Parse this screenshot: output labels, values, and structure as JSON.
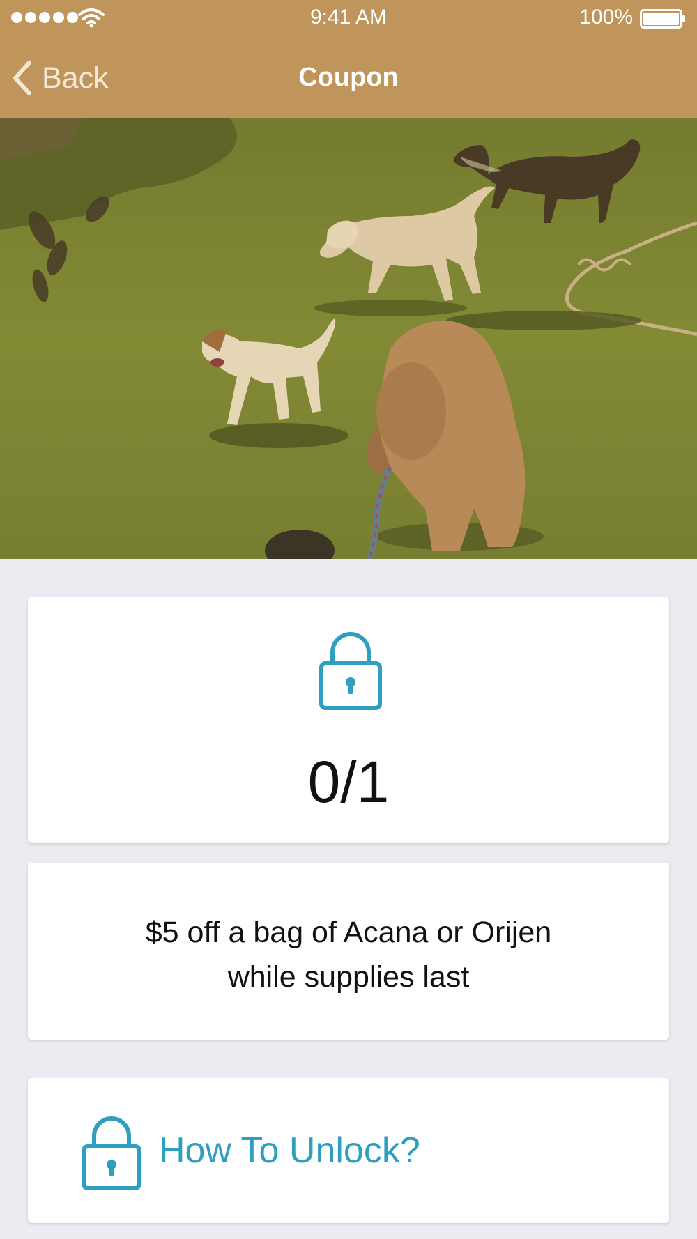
{
  "status_bar": {
    "time": "9:41 AM",
    "battery": "100%",
    "signal_icon": "signal-dots-icon",
    "wifi_icon": "wifi-icon",
    "battery_icon": "battery-icon"
  },
  "nav": {
    "back_label": "Back",
    "back_icon": "chevron-left-icon",
    "title": "Coupon"
  },
  "hero": {
    "subject": "dogs-on-grass-photo"
  },
  "progress": {
    "icon": "lock-icon",
    "count": "0/1"
  },
  "coupon": {
    "description_line1": "$5 off a bag of Acana or Orijen",
    "description_line2": "while supplies last"
  },
  "unlock": {
    "icon": "lock-icon",
    "label": "How To Unlock?"
  },
  "colors": {
    "header": "#bf955b",
    "background": "#ebecf1",
    "accent": "#2e9fc0",
    "card": "#ffffff",
    "text": "#111111"
  }
}
